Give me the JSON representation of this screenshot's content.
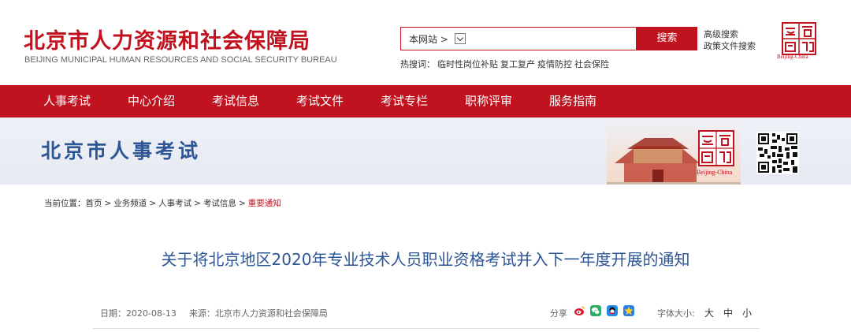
{
  "header": {
    "title": "北京市人力资源和社会保障局",
    "subtitle": "BEIJING MUNICIPAL HUMAN RESOURCES AND SOCIAL SECURITY BUREAU",
    "search": {
      "scope_label": "本网站 >",
      "button_label": "搜索"
    },
    "hotwords": {
      "label": "热搜词：",
      "items": [
        "临时性岗位补贴",
        "复工复产",
        "疫情防控",
        "社会保险"
      ]
    },
    "links": {
      "advanced_search": "高级搜索",
      "policy_search": "政策文件搜索"
    },
    "logo_caption": "Beijing-China"
  },
  "nav": {
    "items": [
      "人事考试",
      "中心介绍",
      "考试信息",
      "考试文件",
      "考试专栏",
      "职称评审",
      "服务指南"
    ]
  },
  "banner": {
    "title": "北京市人事考试",
    "logo_caption": "Beijing-China"
  },
  "breadcrumb": {
    "label": "当前位置：",
    "items": [
      "首页",
      "业务频道",
      "人事考试",
      "考试信息"
    ],
    "current": "重要通知"
  },
  "article": {
    "title": "关于将北京地区2020年专业技术人员职业资格考试并入下一年度开展的通知",
    "date": "日期：2020-08-13",
    "source": "来源：北京市人力资源和社会保障局",
    "share_label": "分享",
    "share_icons": [
      "weibo-icon",
      "wechat-icon",
      "qq-icon",
      "qzone-icon"
    ],
    "font_size_label": "字体大小:",
    "font_sizes": [
      "大",
      "中",
      "小"
    ]
  },
  "colors": {
    "brand_red": "#c1121f",
    "title_blue": "#2c5596"
  }
}
